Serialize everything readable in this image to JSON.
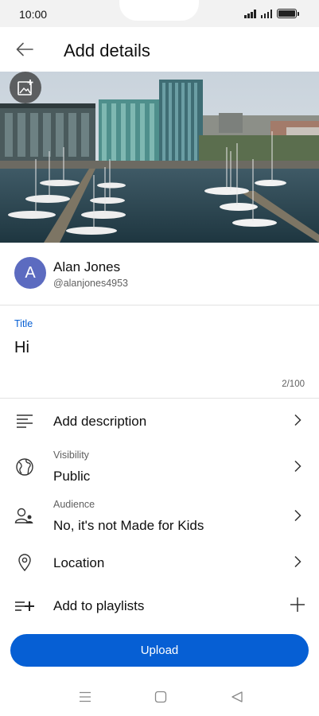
{
  "status_bar": {
    "time": "10:00"
  },
  "header": {
    "title": "Add details"
  },
  "account": {
    "initial": "A",
    "name": "Alan Jones",
    "handle": "@alanjones4953"
  },
  "title_field": {
    "label": "Title",
    "value": "Hi",
    "char_count": "2/100"
  },
  "rows": {
    "description": {
      "label": "Add description",
      "icon": "description-icon"
    },
    "visibility": {
      "sublabel": "Visibility",
      "value": "Public",
      "icon": "globe-icon"
    },
    "audience": {
      "sublabel": "Audience",
      "value": "No, it's not Made for Kids",
      "icon": "audience-icon"
    },
    "location": {
      "label": "Location",
      "icon": "location-pin-icon"
    },
    "playlists": {
      "label": "Add to playlists",
      "icon": "playlist-add-icon"
    }
  },
  "upload": {
    "label": "Upload"
  },
  "colors": {
    "accent": "#065fd4",
    "avatar": "#5c6bc0",
    "text": "#0f0f0f",
    "secondary": "#606060"
  }
}
